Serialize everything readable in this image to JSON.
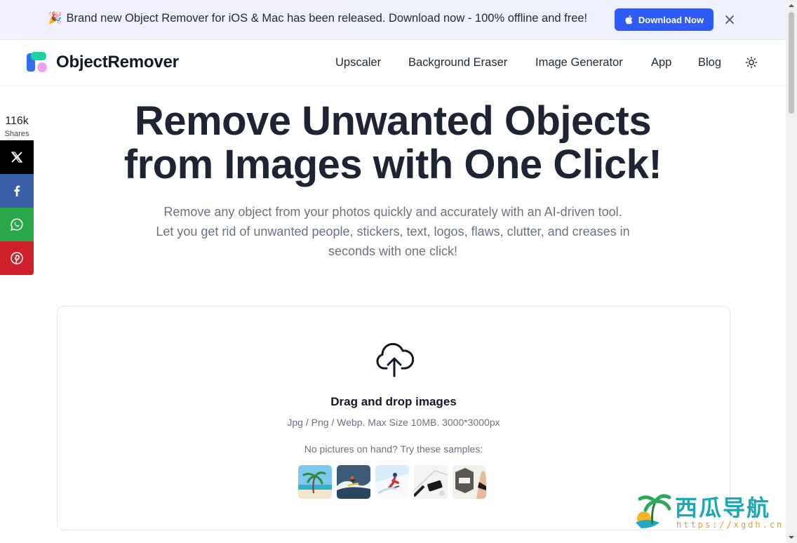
{
  "announcement": {
    "emoji": "🎉",
    "text": "Brand new Object Remover for iOS & Mac has been released. Download now - 100% offline and free!",
    "button_label": "Download Now",
    "button_color": "#2f5cf5"
  },
  "header": {
    "logo_text": "ObjectRemover",
    "nav": [
      "Upscaler",
      "Background Eraser",
      "Image Generator",
      "App",
      "Blog"
    ],
    "theme_icon": "sun-icon"
  },
  "social": {
    "count": "116k",
    "label": "Shares",
    "networks": [
      "x-icon",
      "facebook-icon",
      "whatsapp-icon",
      "pinterest-icon"
    ]
  },
  "hero": {
    "title_line1": "Remove Unwanted Objects",
    "title_line2": "from Images with One Click!",
    "subtitle": "Remove any object from your photos quickly and accurately with an AI-driven tool. Let you get rid of unwanted people, stickers, text, logos, flaws, clutter, and creases in seconds with one click!"
  },
  "upload": {
    "icon": "cloud-upload-icon",
    "title": "Drag and drop images",
    "formats": "Jpg / Png / Webp. Max Size 10MB. 3000*3000px",
    "samples_label": "No pictures on hand? Try these samples:",
    "samples": [
      "beach-palm",
      "surfer",
      "skier",
      "desk-phone",
      "product-box"
    ]
  },
  "watermark": {
    "title": "西瓜导航",
    "url": "https://xgdh.cn"
  }
}
